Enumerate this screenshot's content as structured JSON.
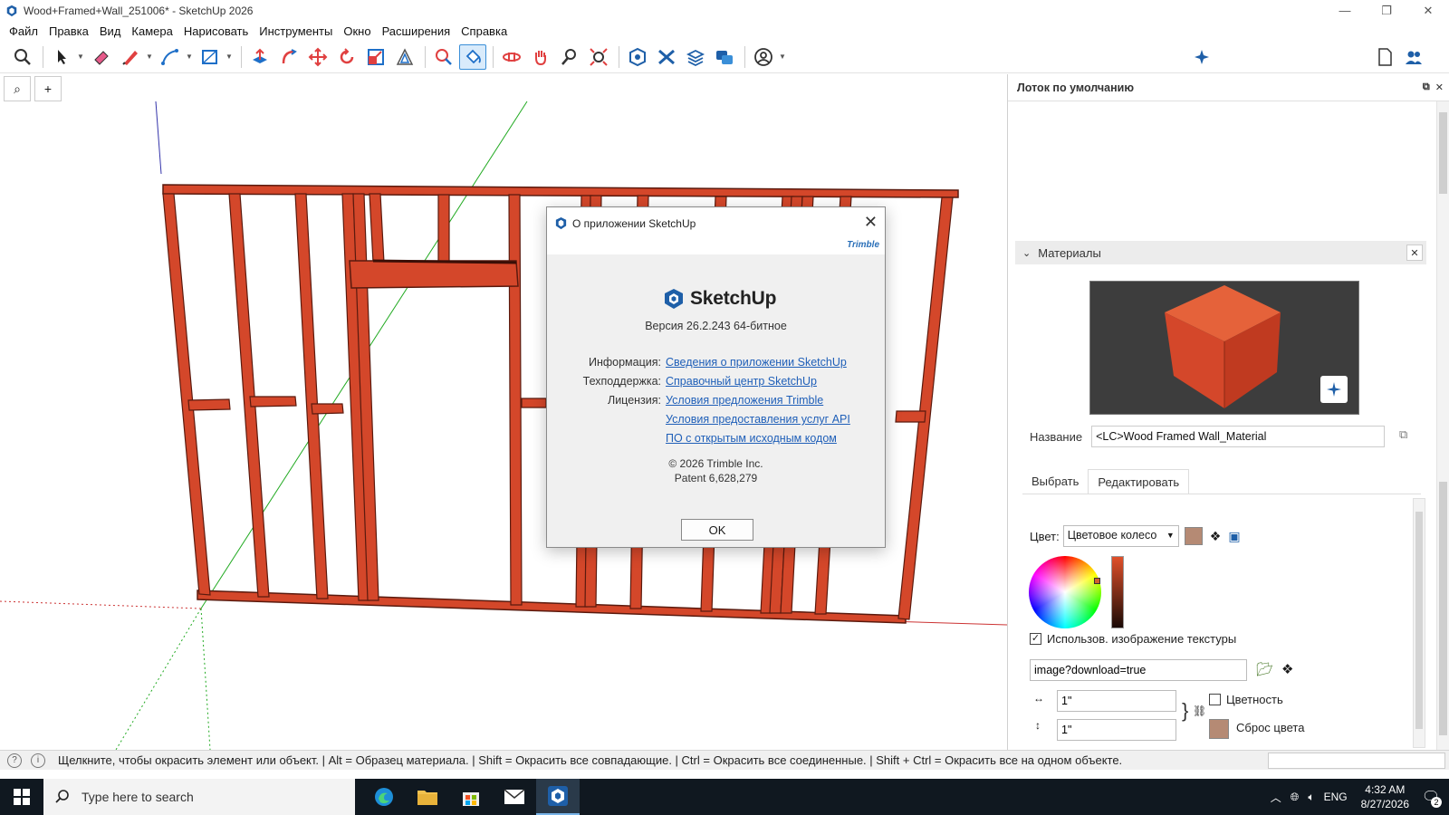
{
  "window": {
    "title": "Wood+Framed+Wall_251006* - SketchUp 2026",
    "minimize": "—",
    "restore": "❐",
    "close": "✕"
  },
  "menu": [
    "Файл",
    "Правка",
    "Вид",
    "Камера",
    "Нарисовать",
    "Инструменты",
    "Окно",
    "Расширения",
    "Справка"
  ],
  "viewport_tabs": {
    "search": "⌕",
    "add": "+"
  },
  "dialog": {
    "title": "О приложении SketchUp",
    "brand": "Trimble",
    "logo_text": "SketchUp",
    "version": "Версия 26.2.243 64-битное",
    "rows": [
      {
        "label": "Информация:",
        "link": "Сведения о приложении SketchUp"
      },
      {
        "label": "Техподдержка:",
        "link": "Справочный центр SketchUp"
      },
      {
        "label": "Лицензия:",
        "link": "Условия предложения Trimble"
      },
      {
        "label": "",
        "link": "Условия предоставления услуг API"
      },
      {
        "label": "",
        "link": "ПО с открытым исходным кодом"
      }
    ],
    "copyright": "© 2026 Trimble Inc.",
    "patent": "Patent 6,628,279",
    "ok": "OK"
  },
  "tray": {
    "title": "Лоток по умолчанию",
    "materials_header": "Материалы",
    "name_label": "Название",
    "name_value": "<LC>Wood Framed Wall_Material",
    "tabs": [
      "Выбрать",
      "Редактировать"
    ],
    "color_label": "Цвет:",
    "color_mode": "Цветовое колесо",
    "use_texture_label": "Использов. изображение текстуры",
    "use_texture_checked": true,
    "texture_file": "image?download=true",
    "width_value": "1\"",
    "height_value": "1\"",
    "colorize_label": "Цветность",
    "reset_color_label": "Сброс цвета",
    "swatch_color": "#b58a74"
  },
  "status": {
    "text": "Щелкните, чтобы окрасить элемент или объект. | Alt = Образец материала. | Shift = Окрасить все совпадающие. | Ctrl = Окрасить все соединенные. | Shift + Ctrl = Окрасить все на одном объекте."
  },
  "taskbar": {
    "search_placeholder": "Type here to search",
    "language": "ENG",
    "time": "4:32 AM",
    "date": "8/27/2026",
    "notifications": "2"
  },
  "colors": {
    "wood": "#d4472a",
    "accent": "#3a8fd8",
    "link": "#1f5fb8"
  }
}
